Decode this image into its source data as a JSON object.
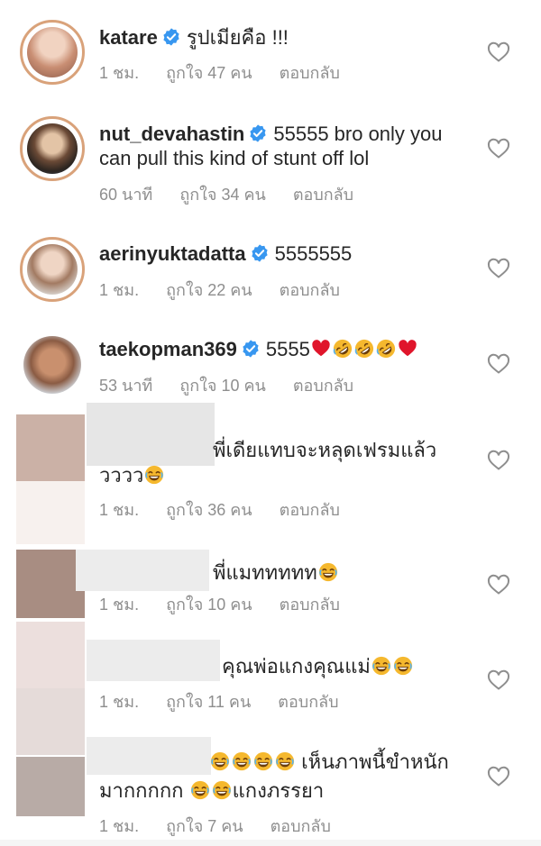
{
  "colors": {
    "verified": "#3897f0",
    "meta_text": "#8e8e8e",
    "heart_outline": "#8e8e8e",
    "ring": "#d9a27a",
    "red_heart": "#e0152b",
    "laugh_face": "#f5b82e"
  },
  "comments": [
    {
      "username": "katare",
      "verified": true,
      "text": "รูปเมียคือ !!!",
      "time": "1 ชม.",
      "likes": "ถูกใจ 47 คน",
      "reply": "ตอบกลับ"
    },
    {
      "username": "nut_devahastin",
      "verified": true,
      "text": "55555 bro only you",
      "text2": "can pull this kind of stunt off lol",
      "time": "60 นาที",
      "likes": "ถูกใจ 34 คน",
      "reply": "ตอบกลับ"
    },
    {
      "username": "aerinyuktadatta",
      "verified": true,
      "text": "5555555",
      "time": "1 ชม.",
      "likes": "ถูกใจ 22 คน",
      "reply": "ตอบกลับ"
    },
    {
      "username": "taekopman369",
      "verified": true,
      "text": "5555",
      "emojis": [
        "red-heart",
        "rofl",
        "rofl",
        "rofl",
        "red-heart"
      ],
      "time": "53 นาที",
      "likes": "ถูกใจ 10 คน",
      "reply": "ตอบกลับ"
    },
    {
      "username": "",
      "verified": false,
      "text": "พี่เดียแทบจะหลุดเฟรมแล้ว",
      "text2": "วววว",
      "emojis": [
        "laugh"
      ],
      "time": "1 ชม.",
      "likes": "ถูกใจ 36 คน",
      "reply": "ตอบกลับ"
    },
    {
      "username": "",
      "verified": false,
      "text": "พี่แมททททท",
      "emojis": [
        "laugh"
      ],
      "time": "1 ชม.",
      "likes": "ถูกใจ 10 คน",
      "reply": "ตอบกลับ"
    },
    {
      "username": "",
      "verified": false,
      "text": "คุณพ่อแกงคุณแม่",
      "emojis": [
        "laugh",
        "laugh"
      ],
      "time": "1 ชม.",
      "likes": "ถูกใจ 11 คน",
      "reply": "ตอบกลับ"
    },
    {
      "username": "",
      "verified": false,
      "text": "เห็นภาพนี้ขำหนัก",
      "lead_emojis": [
        "laugh",
        "laugh",
        "laugh",
        "laugh"
      ],
      "text2": "มากกกกก",
      "mid_emojis": [
        "laugh",
        "laugh"
      ],
      "text3": "แกงภรรยา",
      "time": "1 ชม.",
      "likes": "ถูกใจ 7 คน",
      "reply": "ตอบกลับ"
    }
  ]
}
